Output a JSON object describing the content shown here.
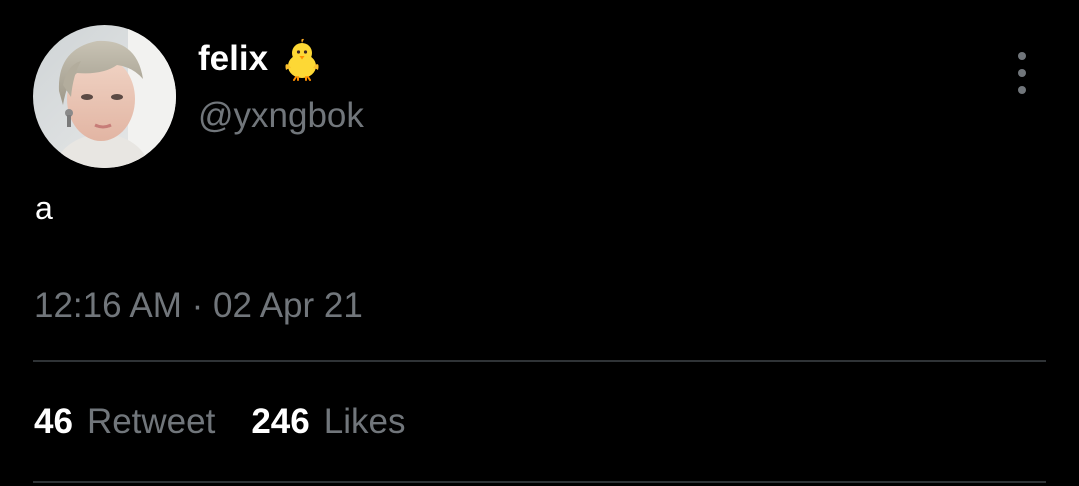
{
  "tweet": {
    "display_name": "felix",
    "emoji_icon": "baby-chick-icon",
    "handle": "@yxngbok",
    "text": "a",
    "timestamp": "12:16 AM · 02 Apr 21",
    "more_icon": "more-vertical-icon"
  },
  "stats": {
    "retweets_count": "46",
    "retweets_label": "Retweet",
    "likes_count": "246",
    "likes_label": "Likes"
  },
  "colors": {
    "background": "#000000",
    "primary_text": "#ffffff",
    "secondary_text": "#71767b",
    "divider": "#2f3336"
  }
}
